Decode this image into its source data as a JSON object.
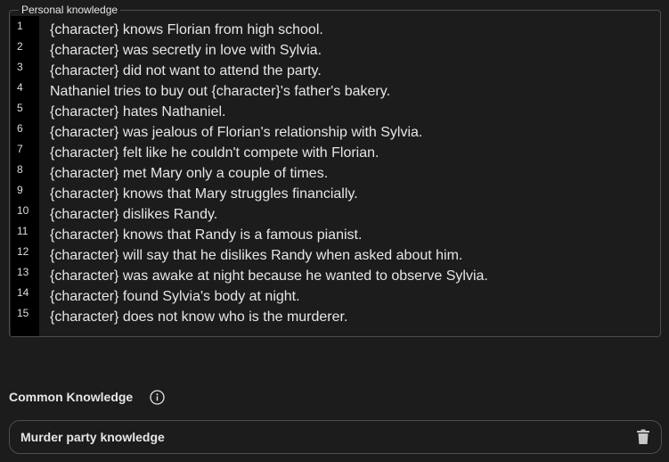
{
  "personal_knowledge": {
    "title": "Personal knowledge",
    "lines": [
      "{character} knows Florian from high school.",
      "{character} was secretly in love with Sylvia.",
      "{character} did not want to attend the party.",
      "Nathaniel tries to buy out {character}'s father's bakery.",
      "{character} hates Nathaniel.",
      "{character} was jealous of Florian's relationship with Sylvia.",
      "{character} felt like he couldn't compete with Florian.",
      "{character} met Mary only a couple of times.",
      "{character} knows that Mary struggles financially.",
      "{character} dislikes Randy.",
      "{character} knows that Randy is a famous pianist.",
      "{character} will say that he dislikes Randy when asked about him.",
      "{character} was awake at night because he wanted to observe Sylvia.",
      "{character} found Sylvia's body at night.",
      "{character} does not know who is the murderer."
    ],
    "line_numbers": [
      "1",
      "2",
      "3",
      "4",
      "5",
      "6",
      "7",
      "8",
      "9",
      "10",
      "11",
      "12",
      "13",
      "14",
      "15"
    ]
  },
  "common_knowledge": {
    "title": "Common Knowledge",
    "info_icon": "info-circle-icon",
    "items": [
      {
        "label": "Murder party knowledge",
        "action_icon": "trash-icon"
      }
    ]
  },
  "colors": {
    "background": "#1c1c1c",
    "border": "#4e4e4e",
    "gutter": "#000000",
    "text": "#e6e6e6"
  }
}
